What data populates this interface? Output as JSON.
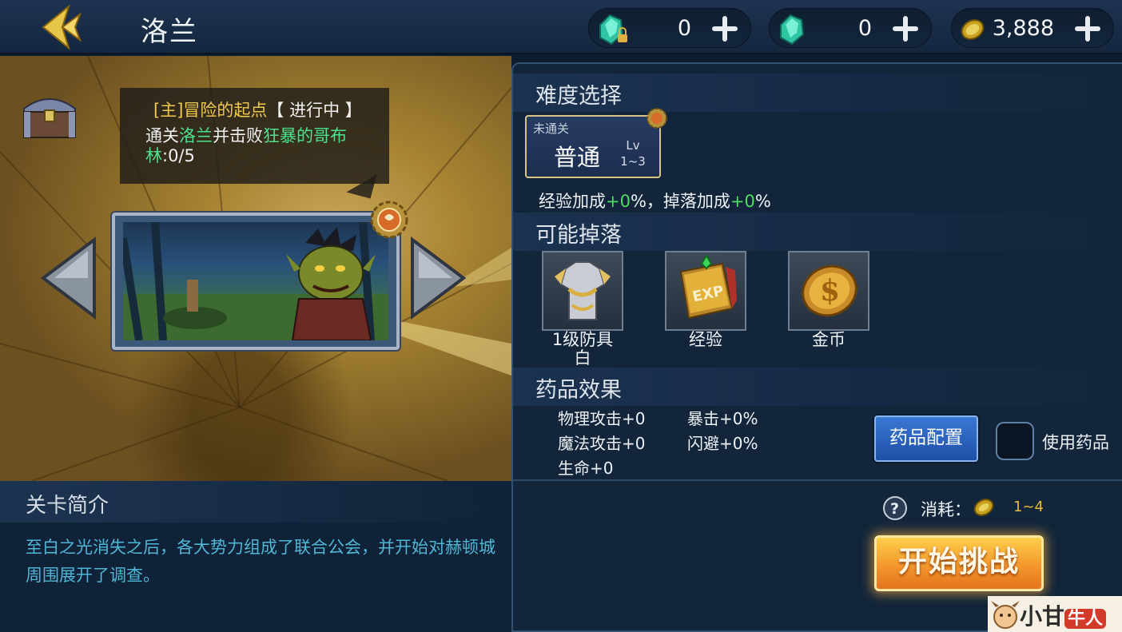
{
  "header": {
    "title": "洛兰",
    "currencies": [
      {
        "icon": "locked-diamond-icon",
        "amount": "0"
      },
      {
        "icon": "diamond-icon",
        "amount": "0"
      },
      {
        "icon": "gold-coin-icon",
        "amount": "3,888"
      }
    ]
  },
  "quest": {
    "title_prefix": "[主]冒险的起点",
    "title_status": "【 进行中 】",
    "desc_part1": "通关",
    "desc_place": "洛兰",
    "desc_part2": "并击败",
    "desc_target": "狂暴的哥布林",
    "desc_progress": ":0/5"
  },
  "intro": {
    "title": "关卡简介",
    "text": "至白之光消失之后，各大势力组成了联合公会，并开始对赫顿城周围展开了调查。"
  },
  "difficulty": {
    "section_title": "难度选择",
    "tag": "未通关",
    "name": "普通",
    "lv_label": "Lv",
    "lv_range": "1~3",
    "bonus_exp_label": "经验加成",
    "bonus_exp_value": "+0",
    "bonus_drop_label": "%，掉落加成",
    "bonus_drop_value": "+0",
    "bonus_suffix": "%"
  },
  "drops": {
    "section_title": "可能掉落",
    "items": [
      {
        "label": "1级防具",
        "sub": "白",
        "icon": "armor-icon"
      },
      {
        "label": "经验",
        "sub": "",
        "icon": "exp-book-icon"
      },
      {
        "label": "金币",
        "sub": "",
        "icon": "gold-coin-icon"
      }
    ]
  },
  "potion": {
    "section_title": "药品效果",
    "stats": {
      "phys_atk": "物理攻击+0",
      "crit": "暴击+0%",
      "magic_atk": "魔法攻击+0",
      "dodge": "闪避+0%",
      "hp": "生命+0"
    },
    "config_button": "药品配置",
    "use_label": "使用药品",
    "use_checked": false
  },
  "cost": {
    "label": "消耗：",
    "value": "1~4"
  },
  "start_button": "开始挑战",
  "watermark": {
    "text1": "小甘",
    "text2": "牛人"
  }
}
